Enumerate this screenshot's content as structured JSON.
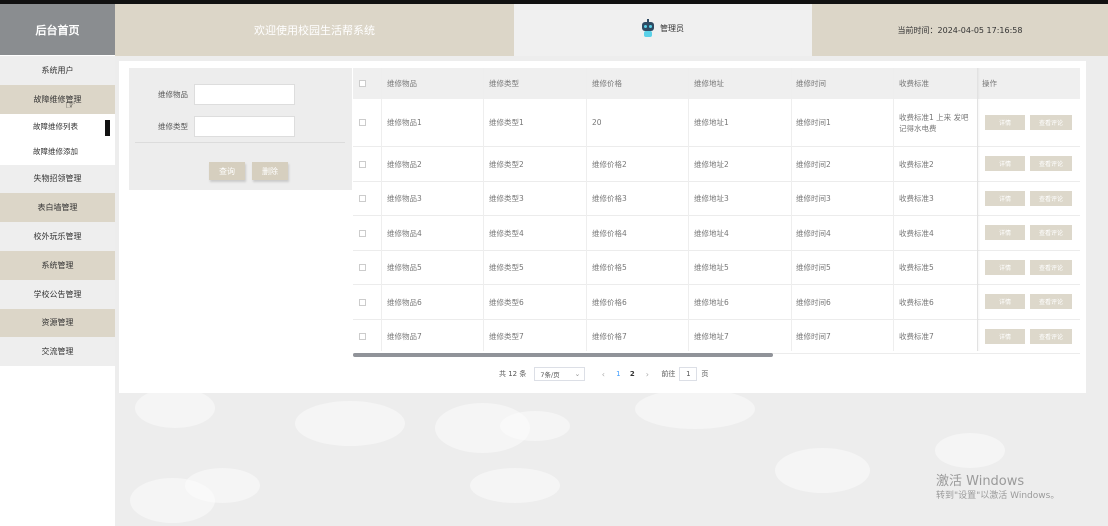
{
  "sidebar": {
    "brand": "后台首页",
    "items": [
      {
        "label": "系统用户"
      },
      {
        "label": "故障维修管理"
      },
      {
        "label": "故障维修列表"
      },
      {
        "label": "故障维修添加"
      },
      {
        "label": "失物招领管理"
      },
      {
        "label": "表白墙管理"
      },
      {
        "label": "校外玩乐管理"
      },
      {
        "label": "系统管理"
      },
      {
        "label": "学校公告管理"
      },
      {
        "label": "资源管理"
      },
      {
        "label": "交流管理"
      }
    ]
  },
  "header": {
    "welcome": "欢迎使用校园生活帮系统",
    "user": "管理员",
    "time_label": "当前时间：",
    "time_value": "2024-04-05 17:16:58"
  },
  "search": {
    "item_label": "维修物品",
    "type_label": "维修类型",
    "query_button": "查询",
    "delete_button": "删除"
  },
  "table": {
    "columns": [
      "维修物品",
      "维修类型",
      "维修价格",
      "维修地址",
      "维修时间",
      "收费标准",
      "操作"
    ],
    "rows": [
      [
        "维修物品1",
        "维修类型1",
        "20",
        "维修地址1",
        "维修时间1",
        "收费标准1 上来 发吧记得水电费"
      ],
      [
        "维修物品2",
        "维修类型2",
        "维修价格2",
        "维修地址2",
        "维修时间2",
        "收费标准2"
      ],
      [
        "维修物品3",
        "维修类型3",
        "维修价格3",
        "维修地址3",
        "维修时间3",
        "收费标准3"
      ],
      [
        "维修物品4",
        "维修类型4",
        "维修价格4",
        "维修地址4",
        "维修时间4",
        "收费标准4"
      ],
      [
        "维修物品5",
        "维修类型5",
        "维修价格5",
        "维修地址5",
        "维修时间5",
        "收费标准5"
      ],
      [
        "维修物品6",
        "维修类型6",
        "维修价格6",
        "维修地址6",
        "维修时间6",
        "收费标准6"
      ],
      [
        "维修物品7",
        "维修类型7",
        "维修价格7",
        "维修地址7",
        "维修时间7",
        "收费标准7"
      ]
    ],
    "detail_button": "详情",
    "comment_button": "查看评论"
  },
  "pagination": {
    "total": "共 12 条",
    "page_size": "7条/页",
    "pages": [
      "1",
      "2"
    ],
    "goto_label": "前往",
    "goto_value": "1",
    "page_unit": "页"
  },
  "watermark": {
    "line1": "激活 Windows",
    "line2": "转到\"设置\"以激活 Windows。"
  }
}
